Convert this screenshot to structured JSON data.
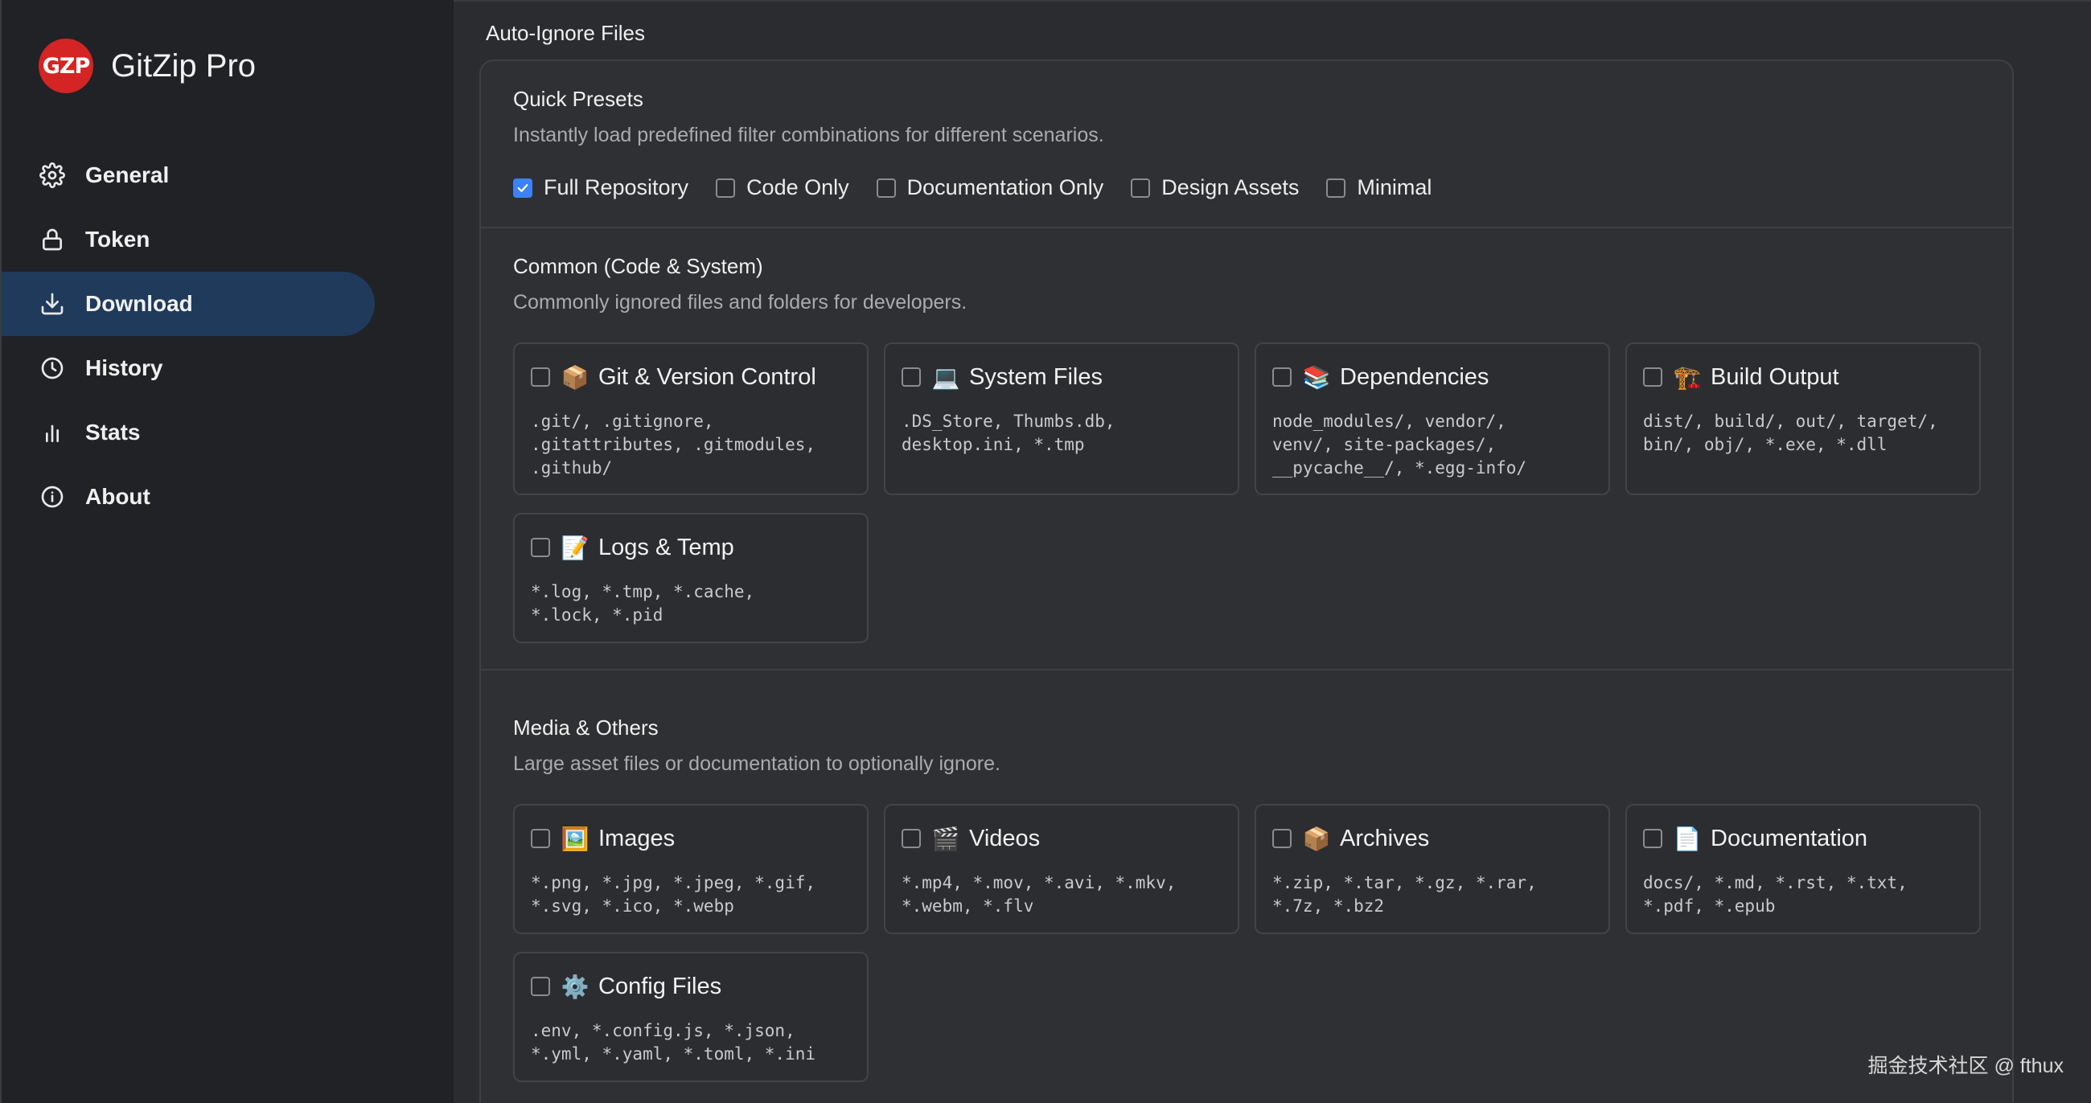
{
  "brand": {
    "logo_text": "GZP",
    "title": "GitZip Pro",
    "logo_color": "#d42424"
  },
  "nav": [
    {
      "label": "General",
      "icon": "gear-icon"
    },
    {
      "label": "Token",
      "icon": "lock-icon"
    },
    {
      "label": "Download",
      "icon": "download-icon",
      "active": true
    },
    {
      "label": "History",
      "icon": "clock-icon"
    },
    {
      "label": "Stats",
      "icon": "bar-chart-icon"
    },
    {
      "label": "About",
      "icon": "info-icon"
    }
  ],
  "section_title": "Auto-Ignore Files",
  "presets": {
    "title": "Quick Presets",
    "desc": "Instantly load predefined filter combinations for different scenarios.",
    "options": [
      {
        "label": "Full Repository",
        "checked": true
      },
      {
        "label": "Code Only",
        "checked": false
      },
      {
        "label": "Documentation Only",
        "checked": false
      },
      {
        "label": "Design Assets",
        "checked": false
      },
      {
        "label": "Minimal",
        "checked": false
      }
    ]
  },
  "common": {
    "title": "Common (Code & System)",
    "desc": "Commonly ignored files and folders for developers.",
    "cards": [
      {
        "emoji": "📦",
        "icon": "package-icon",
        "title": "Git & Version Control",
        "patterns": ".git/, .gitignore,\n.gitattributes, .gitmodules,\n.github/",
        "checked": false
      },
      {
        "emoji": "💻",
        "icon": "laptop-icon",
        "title": "System Files",
        "patterns": ".DS_Store, Thumbs.db,\ndesktop.ini, *.tmp",
        "checked": false
      },
      {
        "emoji": "📚",
        "icon": "books-icon",
        "title": "Dependencies",
        "patterns": "node_modules/, vendor/,\nvenv/, site-packages/,\n__pycache__/, *.egg-info/",
        "checked": false
      },
      {
        "emoji": "🏗️",
        "icon": "construction-icon",
        "title": "Build Output",
        "patterns": "dist/, build/, out/, target/,\nbin/, obj/, *.exe, *.dll",
        "checked": false
      },
      {
        "emoji": "📝",
        "icon": "memo-icon",
        "title": "Logs & Temp",
        "patterns": "*.log, *.tmp, *.cache,\n*.lock, *.pid",
        "checked": false
      }
    ]
  },
  "media": {
    "title": "Media & Others",
    "desc": "Large asset files or documentation to optionally ignore.",
    "cards": [
      {
        "emoji": "🖼️",
        "icon": "picture-icon",
        "title": "Images",
        "patterns": "*.png, *.jpg, *.jpeg, *.gif,\n*.svg, *.ico, *.webp",
        "checked": false
      },
      {
        "emoji": "🎬",
        "icon": "clapper-icon",
        "title": "Videos",
        "patterns": "*.mp4, *.mov, *.avi, *.mkv,\n*.webm, *.flv",
        "checked": false
      },
      {
        "emoji": "📦",
        "icon": "package-icon",
        "title": "Archives",
        "patterns": "*.zip, *.tar, *.gz, *.rar,\n*.7z, *.bz2",
        "checked": false
      },
      {
        "emoji": "📄",
        "icon": "document-icon",
        "title": "Documentation",
        "patterns": "docs/, *.md, *.rst, *.txt,\n*.pdf, *.epub",
        "checked": false
      },
      {
        "emoji": "⚙️",
        "icon": "gear-icon",
        "title": "Config Files",
        "patterns": ".env, *.config.js, *.json,\n*.yml, *.yaml, *.toml, *.ini",
        "checked": false
      }
    ]
  },
  "watermark": "掘金技术社区 @ fthux",
  "colors": {
    "accent": "#3b82f6",
    "active_nav_bg": "#203a5c",
    "sidebar_bg": "#202226",
    "main_bg": "#2b2c2f"
  }
}
